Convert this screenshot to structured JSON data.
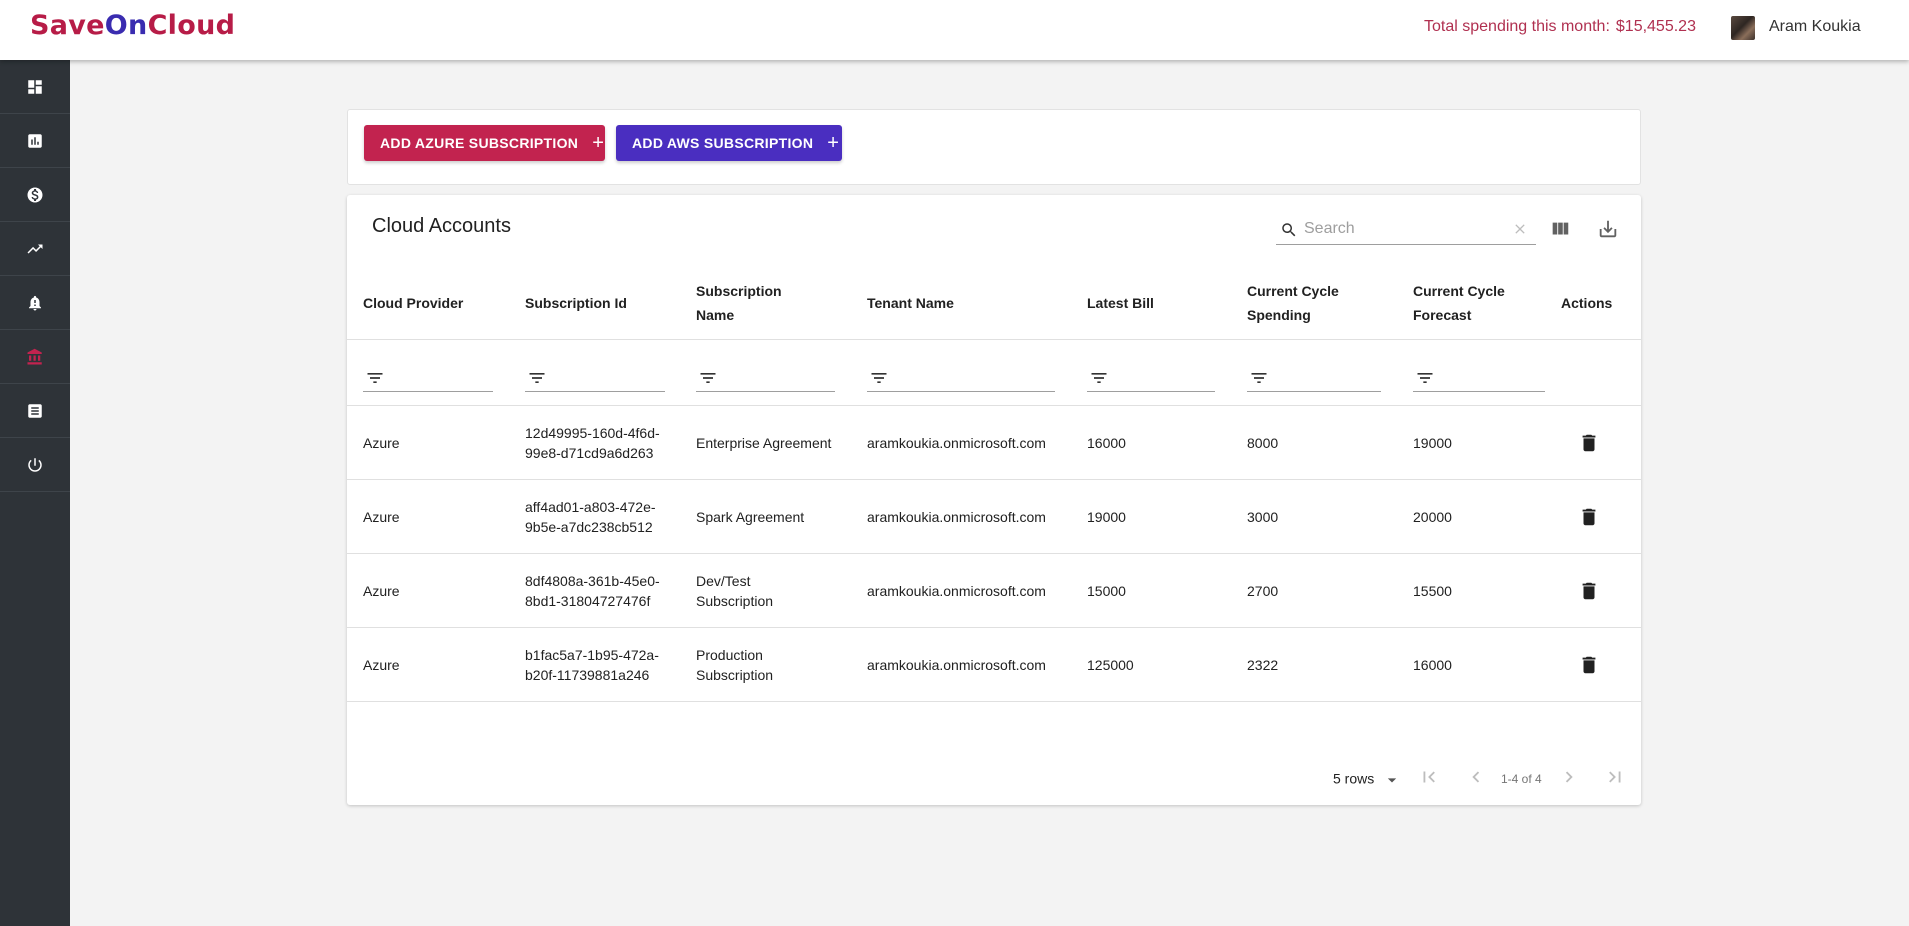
{
  "brand": {
    "part1": "SaveOn",
    "part1a": "Save",
    "part1b": "On",
    "part2": "Cloud"
  },
  "header": {
    "spending_label": "Total spending this month:",
    "spending_amount": "$15,455.23",
    "user_name": "Aram Koukia"
  },
  "sidebar": {
    "items": [
      {
        "name": "dashboard-icon"
      },
      {
        "name": "report-icon"
      },
      {
        "name": "dollar-icon"
      },
      {
        "name": "trending-up-icon"
      },
      {
        "name": "alert-bell-icon"
      },
      {
        "name": "bank-icon",
        "active": true
      },
      {
        "name": "list-icon"
      },
      {
        "name": "power-icon"
      }
    ]
  },
  "actions": {
    "add_azure": "ADD AZURE SUBSCRIPTION",
    "add_aws": "ADD AWS SUBSCRIPTION",
    "plus": "+"
  },
  "table": {
    "title": "Cloud Accounts",
    "search_placeholder": "Search",
    "columns": [
      [
        "Cloud Provider"
      ],
      [
        "Subscription Id"
      ],
      [
        "Subscription",
        "Name"
      ],
      [
        "Tenant Name"
      ],
      [
        "Latest Bill"
      ],
      [
        "Current Cycle",
        "Spending"
      ],
      [
        "Current Cycle",
        "Forecast"
      ],
      [
        "Actions"
      ]
    ],
    "rows": [
      {
        "provider": "Azure",
        "id1": "12d49995-160d-4f6d-",
        "id2": "99e8-d71cd9a6d263",
        "name1": "Enterprise Agreement",
        "name2": "",
        "tenant": "aramkoukia.onmicrosoft.com",
        "bill": "16000",
        "spending": "8000",
        "forecast": "19000"
      },
      {
        "provider": "Azure",
        "id1": "aff4ad01-a803-472e-",
        "id2": "9b5e-a7dc238cb512",
        "name1": "Spark Agreement",
        "name2": "",
        "tenant": "aramkoukia.onmicrosoft.com",
        "bill": "19000",
        "spending": "3000",
        "forecast": "20000"
      },
      {
        "provider": "Azure",
        "id1": "8df4808a-361b-45e0-",
        "id2": "8bd1-31804727476f",
        "name1": "Dev/Test",
        "name2": "Subscription",
        "tenant": "aramkoukia.onmicrosoft.com",
        "bill": "15000",
        "spending": "2700",
        "forecast": "15500"
      },
      {
        "provider": "Azure",
        "id1": "b1fac5a7-1b95-472a-",
        "id2": "b20f-11739881a246",
        "name1": "Production",
        "name2": "Subscription",
        "tenant": "aramkoukia.onmicrosoft.com",
        "bill": "125000",
        "spending": "2322",
        "forecast": "16000"
      }
    ],
    "pagination": {
      "rows_per_page": "5 rows",
      "range": "1-4 of 4"
    }
  },
  "colors": {
    "brand_red": "#c2234f",
    "brand_purple": "#4a2ec0",
    "sidebar_bg": "#2e3338"
  }
}
